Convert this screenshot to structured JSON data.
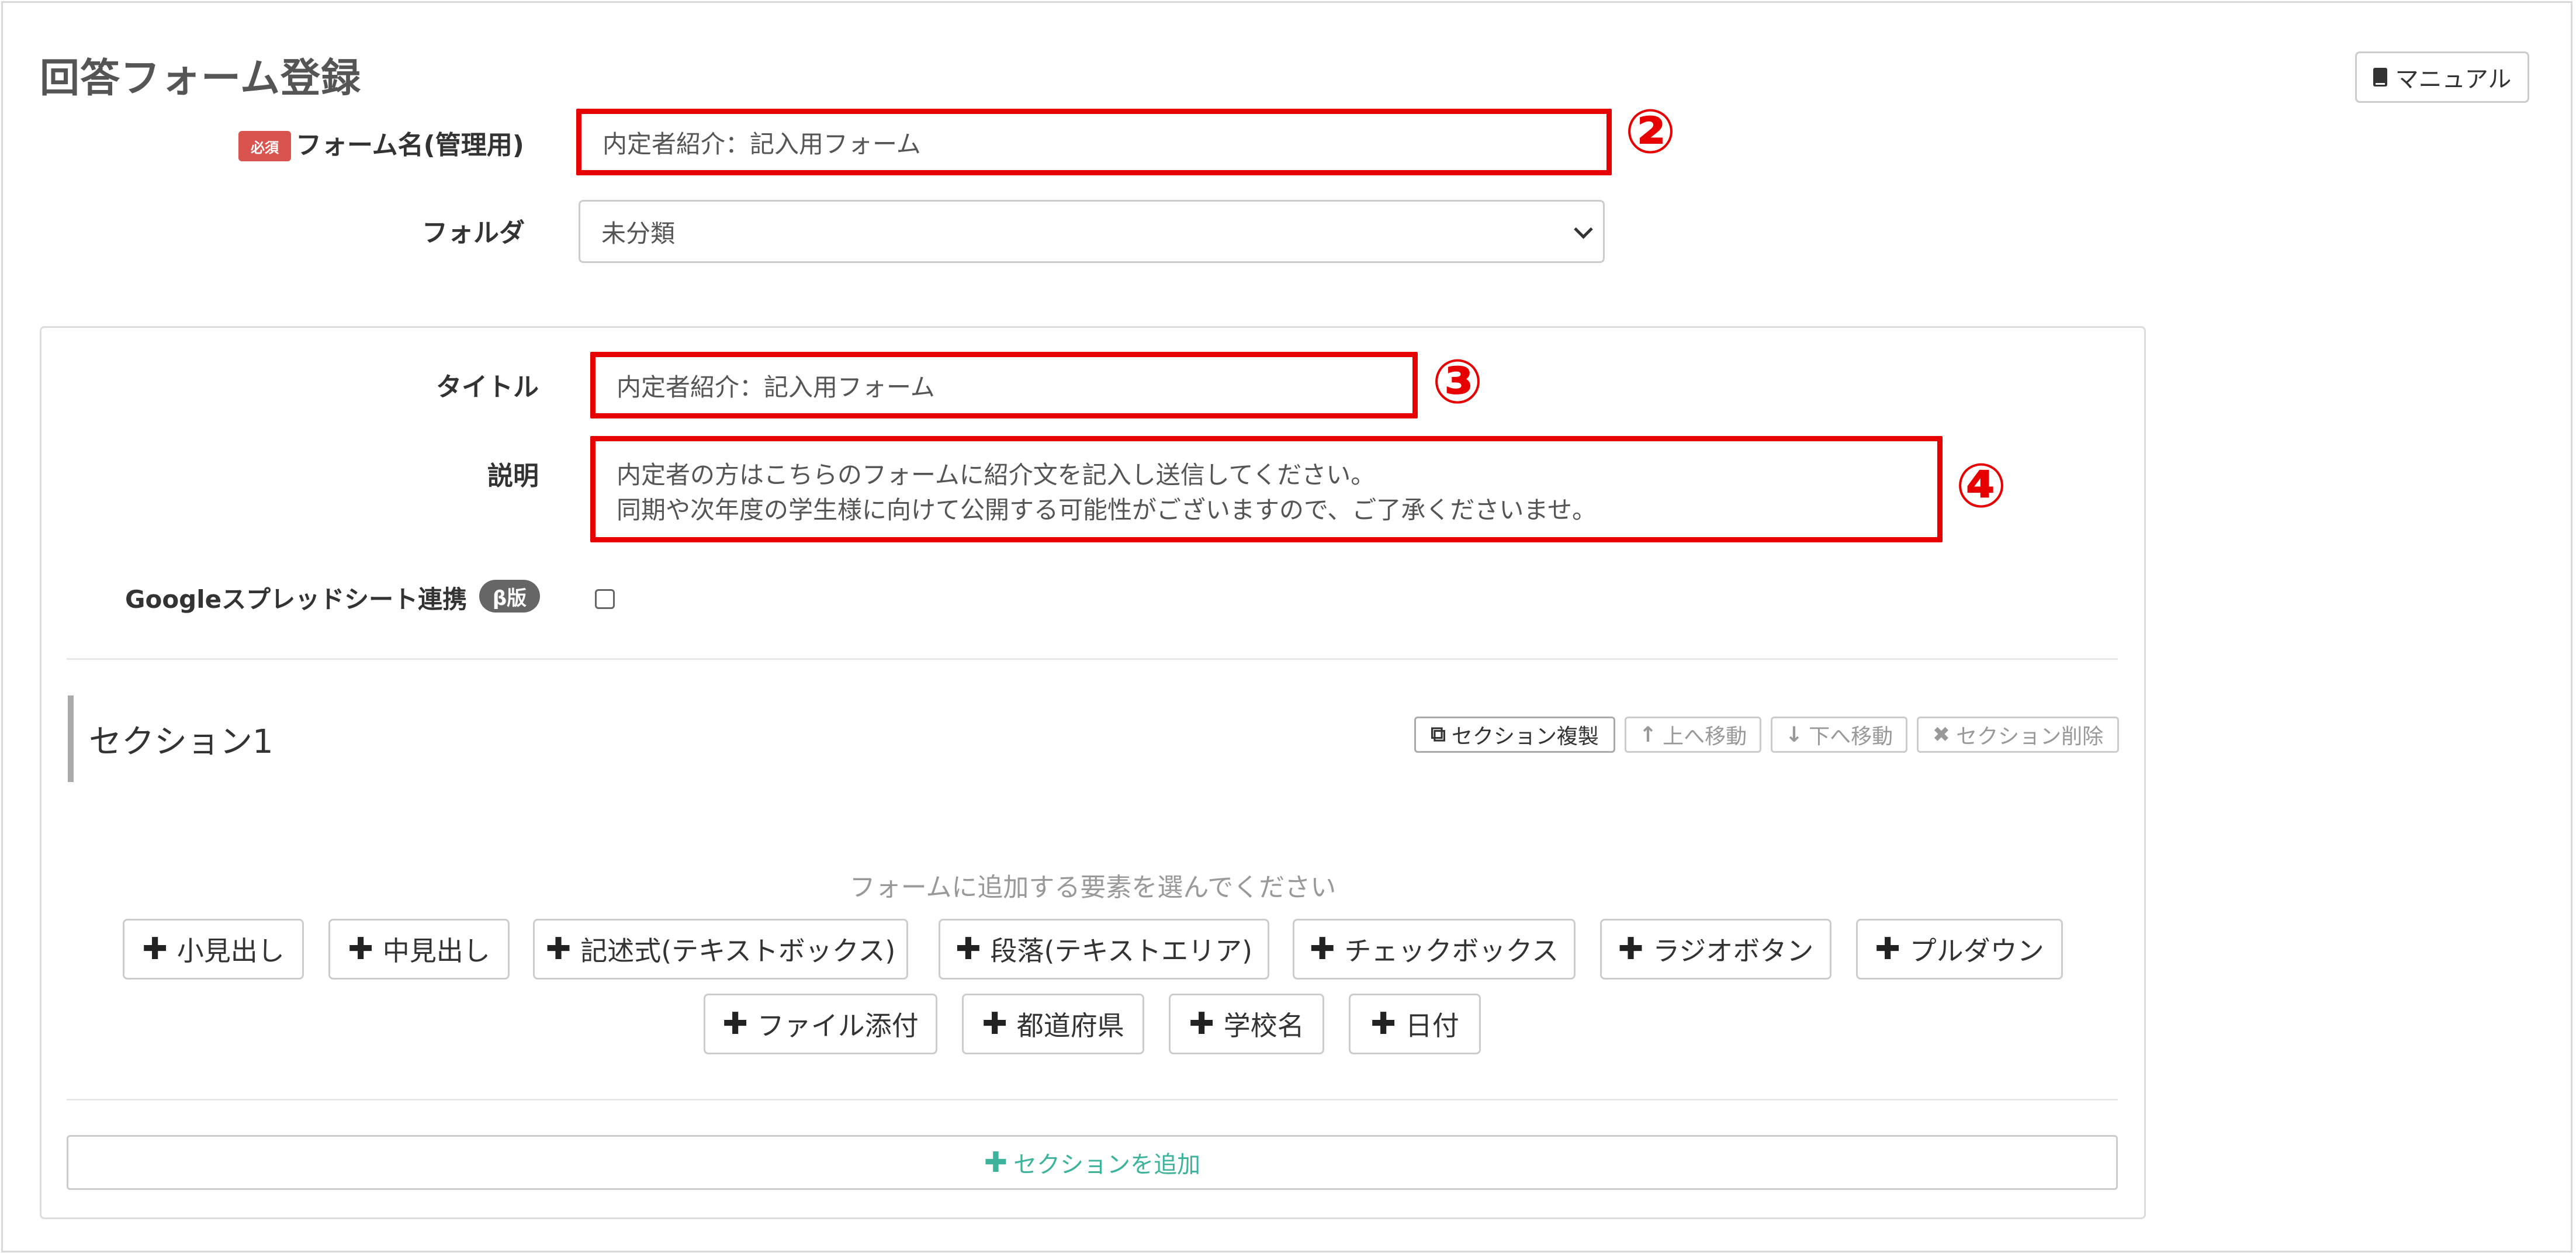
{
  "page": {
    "title": "回答フォーム登録",
    "manual_label": "マニュアル"
  },
  "form": {
    "required_badge": "必須",
    "name_label": "フォーム名(管理用)",
    "name_value": "内定者紹介：記入用フォーム",
    "folder_label": "フォルダ",
    "folder_value": "未分類"
  },
  "panel": {
    "title_label": "タイトル",
    "title_value": "内定者紹介：記入用フォーム",
    "desc_label": "説明",
    "desc_line1": "内定者の方はこちらのフォームに紹介文を記入し送信してください。",
    "desc_line2": "同期や次年度の学生様に向けて公開する可能性がございますので、ご了承くださいませ。",
    "sheets_label": "Googleスプレッドシート連携",
    "beta_badge": "β版",
    "sheets_checked": false
  },
  "annotations": {
    "n2": "②",
    "n3": "③",
    "n4": "④",
    "color": "#e60000"
  },
  "section": {
    "title": "セクション1",
    "copy": "セクション複製",
    "up": "上へ移動",
    "down": "下へ移動",
    "delete": "セクション削除",
    "hint": "フォームに追加する要素を選んでください",
    "add_buttons_row1": [
      "小見出し",
      "中見出し",
      "記述式(テキストボックス)",
      "段落(テキストエリア)",
      "チェックボックス",
      "ラジオボタン",
      "プルダウン"
    ],
    "add_buttons_row2": [
      "ファイル添付",
      "都道府県",
      "学校名",
      "日付"
    ],
    "add_section": "セクションを追加"
  },
  "colors": {
    "required": "#d9534f",
    "add_section": "#3cb39a"
  }
}
